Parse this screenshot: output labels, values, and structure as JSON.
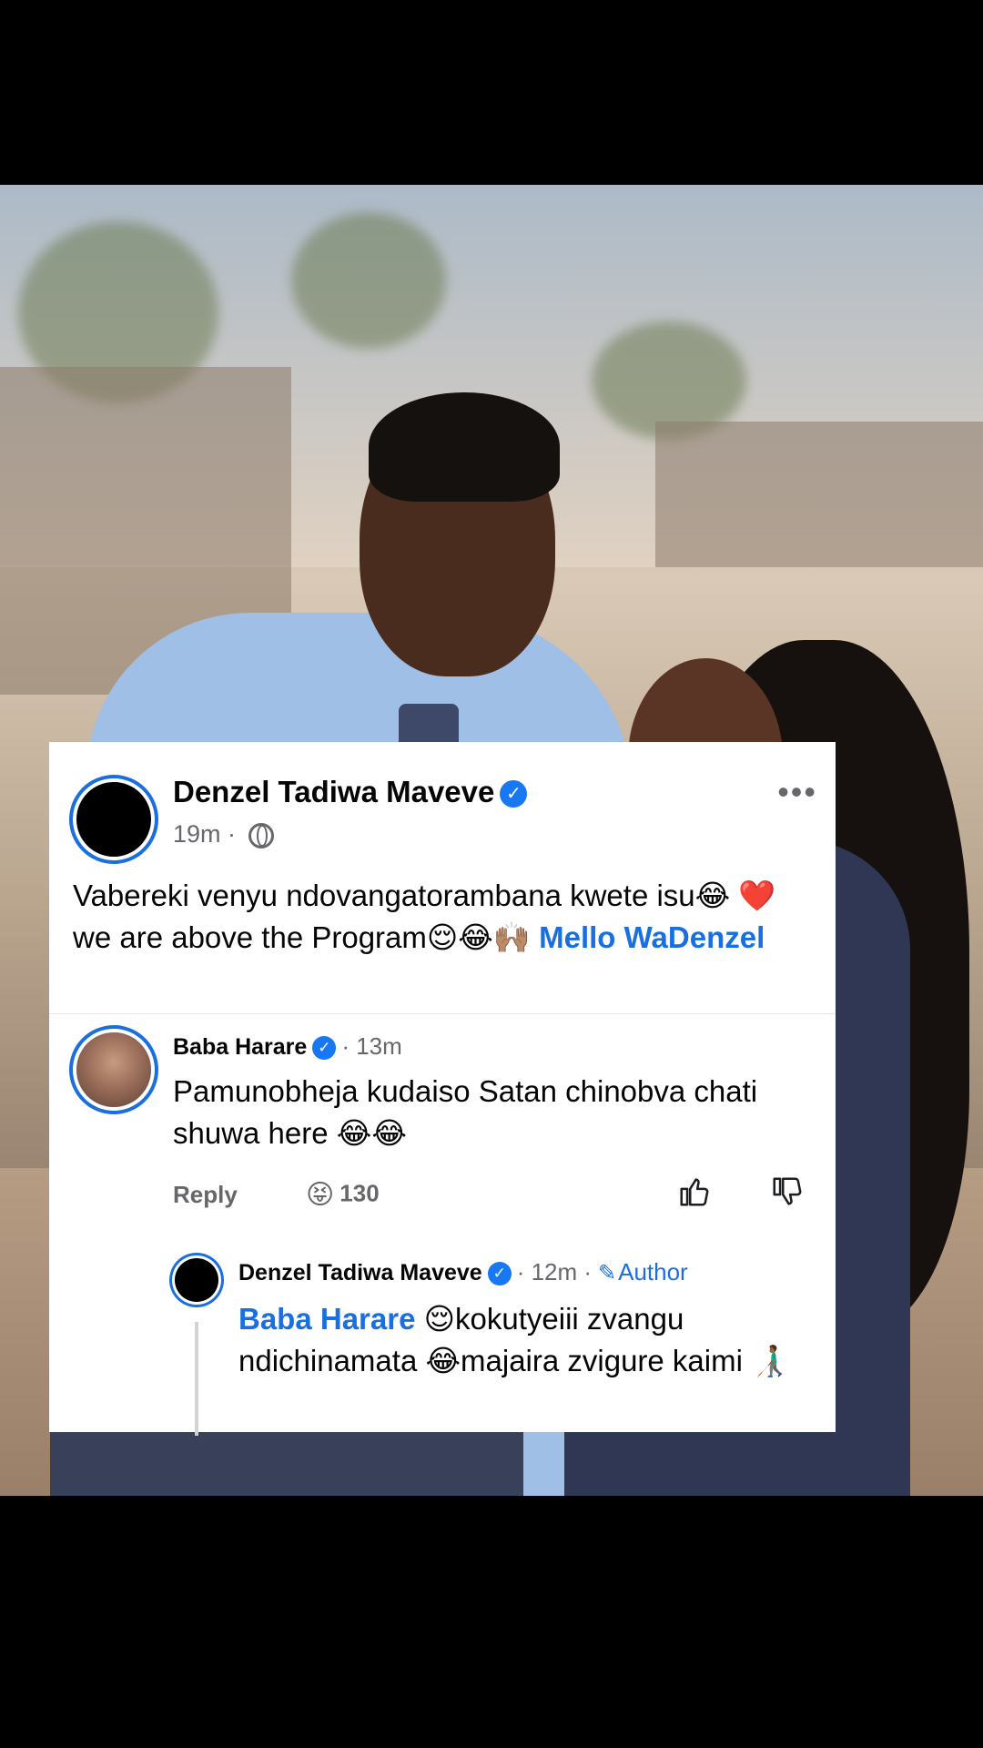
{
  "post": {
    "author": "Denzel Tadiwa Maveve",
    "time": "19m",
    "text_before": "Vabereki venyu ndovangatorambana kwete isu😂 ❤️ we are above the Program😌😂🙌🏽 ",
    "tagged": "Mello WaDenzel",
    "more_label": "•••"
  },
  "comment": {
    "author": "Baba Harare",
    "time": "· 13m",
    "text": "Pamunobheja kudaiso Satan chinobva chati shuwa here 😂😂",
    "reply_label": "Reply",
    "reaction_emoji": "😝",
    "reaction_count": "130"
  },
  "reply": {
    "author": "Denzel Tadiwa Maveve",
    "time": "· 12m ·",
    "author_badge": "Author",
    "mention": "Baba Harare",
    "text": " 😌kokutyeiii zvangu ndichinamata 😂majaira zvigure kaimi 👨🏾‍🦯"
  },
  "colors": {
    "accent": "#1a6fe0",
    "verified": "#1877f2",
    "muted": "#65676b"
  },
  "icons": [
    "globe-icon",
    "verified-icon",
    "more-icon",
    "thumbs-up-icon",
    "thumbs-down-icon",
    "pencil-icon"
  ]
}
